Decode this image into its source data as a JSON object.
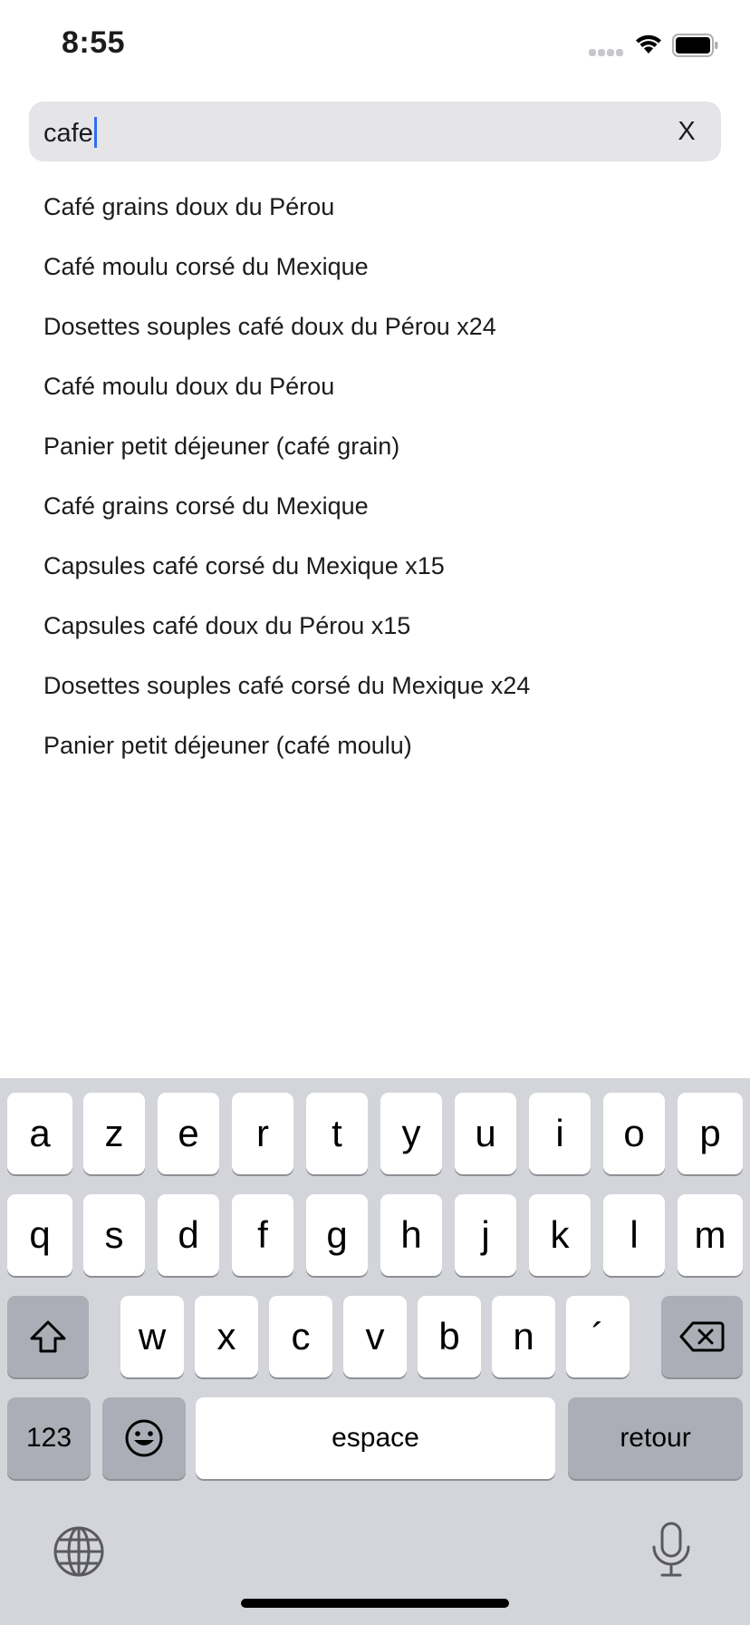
{
  "status_bar": {
    "time": "8:55",
    "signal_icon": "cellular-signal-icon",
    "wifi_icon": "wifi-icon",
    "battery_icon": "battery-full-icon"
  },
  "search": {
    "value": "cafe",
    "clear_label": "X"
  },
  "suggestions": [
    "Café grains doux du Pérou",
    "Café moulu corsé du Mexique",
    "Dosettes souples café doux du Pérou x24",
    "Café moulu doux du Pérou",
    "Panier petit déjeuner (café grain)",
    "Café grains corsé du Mexique",
    "Capsules café corsé du Mexique x15",
    "Capsules café doux du Pérou x15",
    "Dosettes souples café corsé du Mexique x24",
    "Panier petit déjeuner (café moulu)"
  ],
  "keyboard": {
    "row1": [
      "a",
      "z",
      "e",
      "r",
      "t",
      "y",
      "u",
      "i",
      "o",
      "p"
    ],
    "row2": [
      "q",
      "s",
      "d",
      "f",
      "g",
      "h",
      "j",
      "k",
      "l",
      "m"
    ],
    "row3": [
      "w",
      "x",
      "c",
      "v",
      "b",
      "n",
      "´"
    ],
    "numbers_label": "123",
    "space_label": "espace",
    "return_label": "retour",
    "shift_icon": "shift-icon",
    "delete_icon": "delete-backspace-icon",
    "emoji_icon": "emoji-icon",
    "globe_icon": "globe-icon",
    "mic_icon": "microphone-icon"
  },
  "colors": {
    "caret": "#2f6cf5",
    "search_field_bg": "#e5e5e7",
    "keyboard_bg": "#d3d5db",
    "function_key_bg": "#abaeb6"
  }
}
